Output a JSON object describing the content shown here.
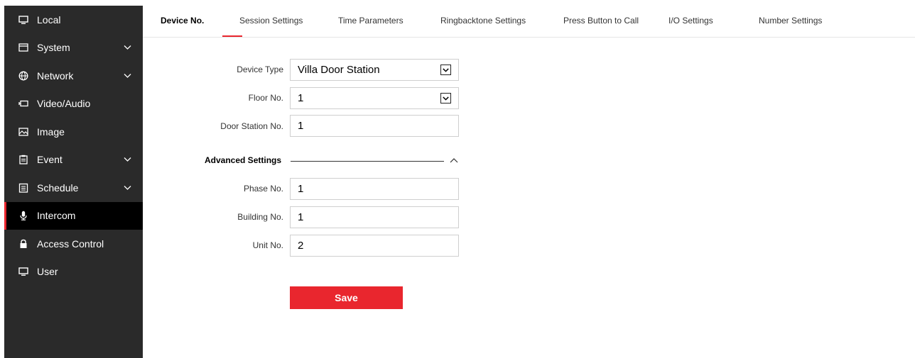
{
  "sidebar": {
    "items": [
      {
        "label": "Local",
        "icon": "monitor-icon"
      },
      {
        "label": "System",
        "icon": "window-icon",
        "expandable": true
      },
      {
        "label": "Network",
        "icon": "globe-icon",
        "expandable": true
      },
      {
        "label": "Video/Audio",
        "icon": "video-icon"
      },
      {
        "label": "Image",
        "icon": "image-icon"
      },
      {
        "label": "Event",
        "icon": "clipboard-icon",
        "expandable": true
      },
      {
        "label": "Schedule",
        "icon": "calendar-icon",
        "expandable": true
      },
      {
        "label": "Intercom",
        "icon": "microphone-icon",
        "active": true
      },
      {
        "label": "Access Control",
        "icon": "lock-icon"
      },
      {
        "label": "User",
        "icon": "monitor-icon"
      }
    ]
  },
  "tabs": [
    {
      "label": "Device No.",
      "active": true
    },
    {
      "label": "Session Settings"
    },
    {
      "label": "Time Parameters"
    },
    {
      "label": "Ringbacktone Settings"
    },
    {
      "label": "Press Button to Call"
    },
    {
      "label": "I/O Settings"
    },
    {
      "label": "Number Settings"
    }
  ],
  "form": {
    "device_type": {
      "label": "Device Type",
      "value": "Villa Door Station"
    },
    "floor_no": {
      "label": "Floor No.",
      "value": "1"
    },
    "door_station_no": {
      "label": "Door Station No.",
      "value": "1"
    },
    "advanced": {
      "title": "Advanced Settings",
      "phase_no": {
        "label": "Phase No.",
        "value": "1"
      },
      "building_no": {
        "label": "Building No.",
        "value": "1"
      },
      "unit_no": {
        "label": "Unit No.",
        "value": "2"
      }
    },
    "save_label": "Save"
  },
  "colors": {
    "accent": "#e9262e",
    "sidebar_bg": "#2a2a2a",
    "sidebar_active_bg": "#000000"
  }
}
